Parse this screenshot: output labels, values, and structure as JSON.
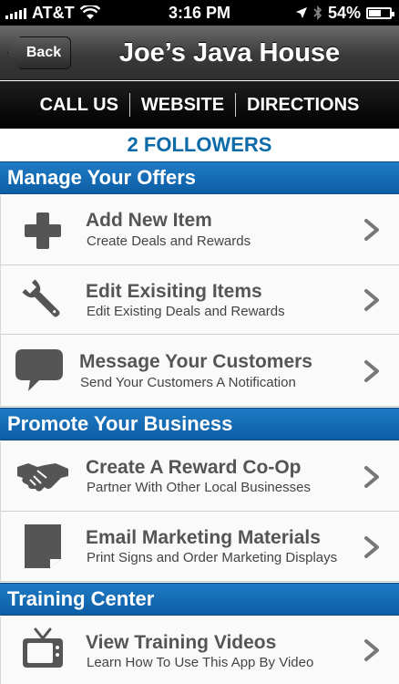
{
  "status_bar": {
    "carrier": "AT&T",
    "time": "3:16 PM",
    "battery": "54%"
  },
  "nav": {
    "back_label": "Back",
    "title": "Joe’s Java House"
  },
  "actions": {
    "call_label": "CALL US",
    "website_label": "WEBSITE",
    "directions_label": "DIRECTIONS"
  },
  "followers_label": "2 FOLLOWERS",
  "sections": {
    "manage": {
      "title": "Manage Your Offers",
      "items": [
        {
          "title": "Add New Item",
          "subtitle": "Create Deals and Rewards",
          "icon": "plus-icon"
        },
        {
          "title": "Edit Exisiting Items",
          "subtitle": "Edit Existing Deals and Rewards",
          "icon": "wrench-icon"
        },
        {
          "title": "Message Your Customers",
          "subtitle": "Send Your Customers A Notification",
          "icon": "speech-bubble-icon"
        }
      ]
    },
    "promote": {
      "title": "Promote Your Business",
      "items": [
        {
          "title": "Create A Reward Co-Op",
          "subtitle": "Partner With Other Local Businesses",
          "icon": "handshake-icon"
        },
        {
          "title": "Email Marketing Materials",
          "subtitle": "Print Signs and Order Marketing Displays",
          "icon": "document-icon"
        }
      ]
    },
    "training": {
      "title": "Training Center",
      "items": [
        {
          "title": "View Training Videos",
          "subtitle": "Learn How To Use This App By Video",
          "icon": "tv-icon"
        }
      ]
    }
  },
  "colors": {
    "section_blue": "#1f7bc4",
    "followers_blue": "#0b6aa8",
    "icon_gray": "#555555"
  }
}
